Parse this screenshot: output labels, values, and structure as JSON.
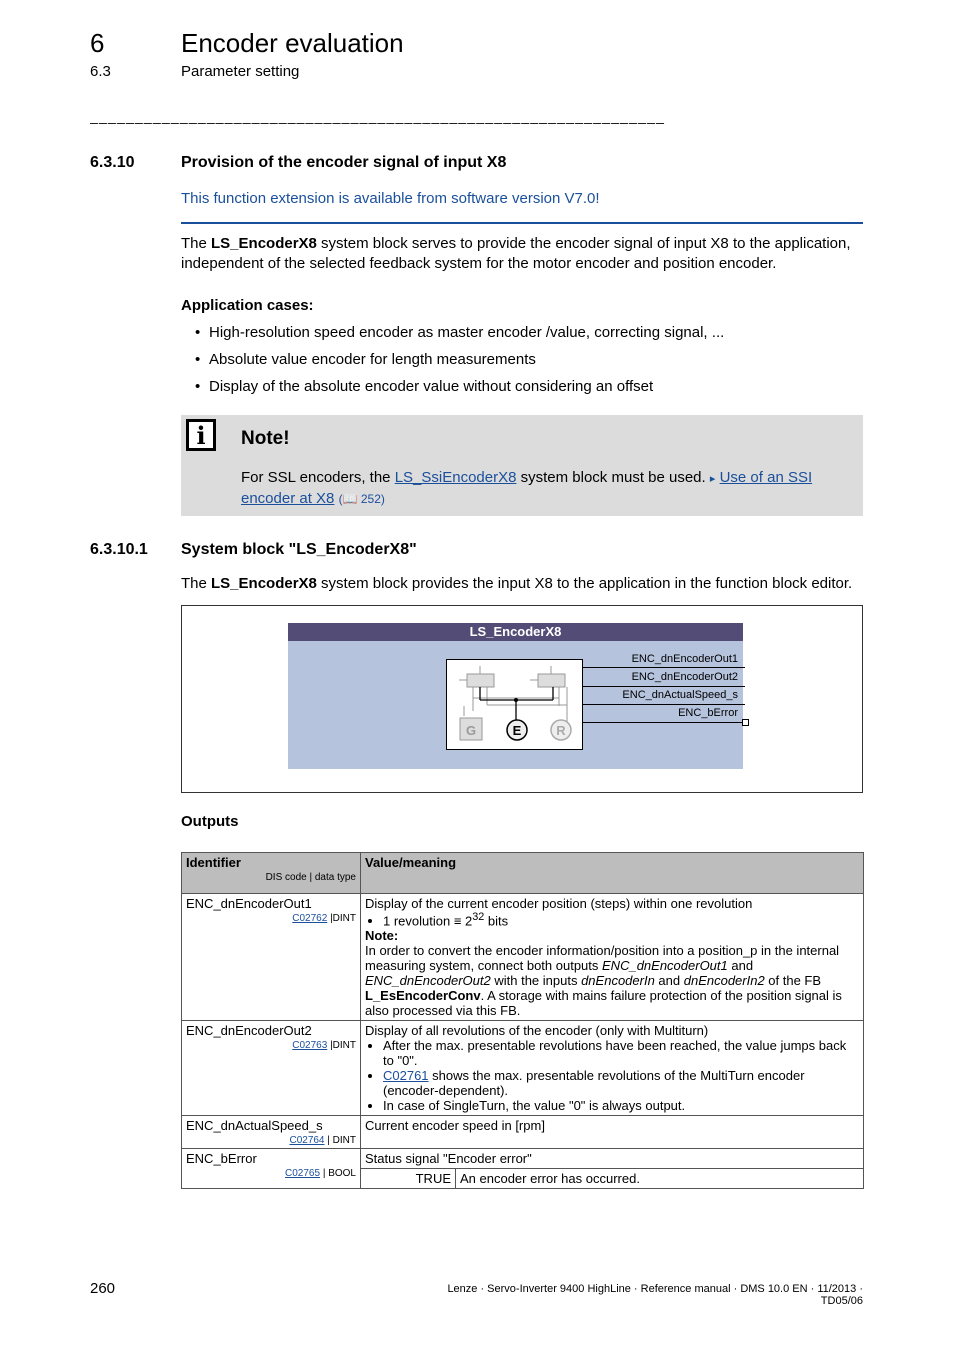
{
  "header": {
    "chapter_number": "6",
    "chapter_title": "Encoder evaluation",
    "section_number": "6.3",
    "section_title": "Parameter setting",
    "separator": "________________________________________________________________"
  },
  "section": {
    "number": "6.3.10",
    "title": "Provision of the encoder signal of input X8",
    "availability": "This function extension is available from software version V7.0!",
    "intro_prefix": "The ",
    "intro_bold": "LS_EncoderX8",
    "intro_rest": " system block serves to provide the encoder signal of input X8 to the application, independent of the selected feedback system for the motor encoder and position encoder.",
    "cases_heading": "Application cases:",
    "cases": [
      "High-resolution speed encoder as master encoder /value, correcting signal, ...",
      "Absolute value encoder for length measurements",
      "Display of the absolute encoder value without considering an offset"
    ]
  },
  "note": {
    "title": "Note!",
    "text_prefix": "For SSL encoders, the ",
    "link1": "LS_SsiEncoderX8",
    "text_mid": " system block must be used. ",
    "arrow": "▸",
    "link2": "Use of an SSI encoder at X8",
    "page_ref": "(📖 252)"
  },
  "subsection": {
    "number": "6.3.10.1",
    "title": "System block \"LS_EncoderX8\"",
    "text_prefix": "The ",
    "text_bold": "LS_EncoderX8",
    "text_rest": " system block provides the input X8 to the application in the function block editor."
  },
  "diagram": {
    "block_name": "LS_EncoderX8",
    "outputs": [
      "ENC_dnEncoderOut1",
      "ENC_dnEncoderOut2",
      "ENC_dnActualSpeed_s",
      "ENC_bError"
    ],
    "sources": [
      "G",
      "E",
      "R"
    ]
  },
  "outputs": {
    "heading": "Outputs",
    "col_identifier": "Identifier",
    "col_sub": "DIS code | data type",
    "col_value": "Value/meaning",
    "rows": [
      {
        "id": "ENC_dnEncoderOut1",
        "code": "C02762",
        "type": "|DINT",
        "desc": "Display of the current encoder position (steps) within one revolution",
        "bullet_prefix": "1 revolution ≡ 2",
        "bullet_sup": "32",
        "bullet_suffix": " bits",
        "note_label": "Note:",
        "note_p1": "In order to convert the encoder information/position into a position_p in the internal measuring system, connect both outputs ",
        "note_i1": "ENC_dnEncoderOut1",
        "note_p2": " and ",
        "note_i2": "ENC_dnEncoderOut2",
        "note_p3": " with the inputs ",
        "note_i3": "dnEncoderIn",
        "note_p4": " and ",
        "note_i4": "dnEncoderIn2",
        "note_p5": " of the FB ",
        "note_b": "L_EsEncoderConv",
        "note_p6": ". A storage with mains failure protection of the position signal is also processed via this FB."
      },
      {
        "id": "ENC_dnEncoderOut2",
        "code": "C02763",
        "type": "|DINT",
        "desc": "Display of all revolutions of the encoder (only with Multiturn)",
        "b1": "After the max. presentable revolutions have been reached, the value jumps back to \"0\".",
        "b2_link": "C02761",
        "b2_rest": " shows the max. presentable revolutions of the MultiTurn encoder (encoder-dependent).",
        "b3": "In case of SingleTurn, the value \"0\" is always output."
      },
      {
        "id": "ENC_dnActualSpeed_s",
        "code": "C02764",
        "type": "| DINT",
        "desc": "Current encoder speed in [rpm]"
      },
      {
        "id": "ENC_bError",
        "code": "C02765",
        "type": "| BOOL",
        "desc": "Status signal \"Encoder error\"",
        "value": "TRUE",
        "value_meaning": "An encoder error has occurred."
      }
    ]
  },
  "footer": {
    "page": "260",
    "text": "Lenze · Servo-Inverter 9400 HighLine · Reference manual · DMS 10.0 EN · 11/2013 · TD05/06"
  }
}
